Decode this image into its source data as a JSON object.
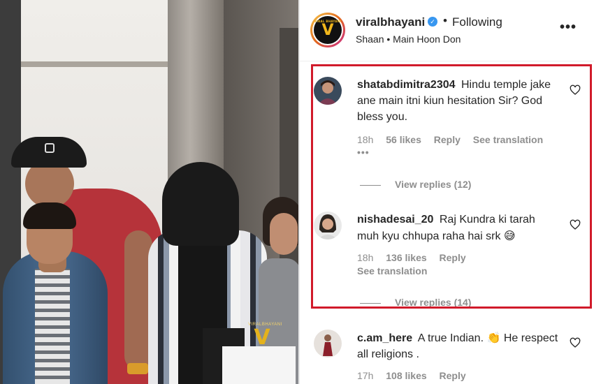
{
  "post": {
    "username": "viralbhayani",
    "verified_icon": "verified-check-icon",
    "separator": "•",
    "follow_status": "Following",
    "subline": "Shaan • Main Hoon Don",
    "avatar_letter": "V",
    "avatar_tiny": "VIRAL BHAYANI",
    "more_icon": "more-options-icon",
    "more_glyph": "•••"
  },
  "media": {
    "watermark_text": "VIRALBHAYANI",
    "watermark_letter": "V"
  },
  "comments": [
    {
      "username": "shatabdimitra2304",
      "text": "Hindu temple jake ane main itni kiun hesitation Sir? God bless you.",
      "time": "18h",
      "likes": "56 likes",
      "reply": "Reply",
      "translation": "See translation",
      "more": "•••",
      "view_replies": "View replies (12)"
    },
    {
      "username": "nishadesai_20",
      "text": "Raj Kundra ki tarah muh kyu chhupa raha hai srk",
      "emoji": "😅",
      "time": "18h",
      "likes": "136 likes",
      "reply": "Reply",
      "translation": "See translation",
      "view_replies": "View replies (14)"
    },
    {
      "username": "c.am_here",
      "text": "A true Indian.",
      "emoji": "👏",
      "text2": "He respect all religions .",
      "time": "17h",
      "likes": "108 likes",
      "reply": "Reply"
    }
  ],
  "colors": {
    "highlight": "#d11a2a",
    "verified": "#3897f0",
    "meta": "#8e8e8e",
    "text": "#262626"
  }
}
